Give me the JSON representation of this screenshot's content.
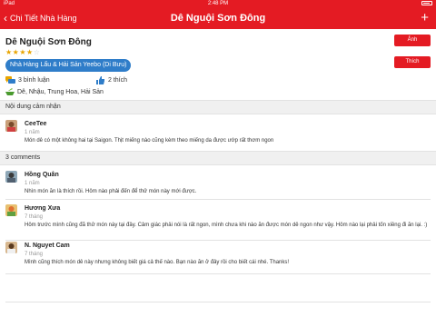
{
  "status_bar": {
    "carrier": "iPad",
    "time": "2:48 PM"
  },
  "nav_bar": {
    "back_label": "Chi Tiết Nhà Hàng",
    "title": "Dê Nguội Sơn Đông",
    "back_icon": "chevron-left-icon",
    "add_icon": "plus-icon"
  },
  "restaurant": {
    "name": "Dê Nguội Sơn Đông",
    "rating": 4,
    "rating_max": 5,
    "category": "Nhà Hàng Lẩu & Hải Sản Yeebo (Di Bưu)",
    "comments_count": "3 bình luận",
    "likes_count": "2 thích",
    "tags": "Dê, Nhậu, Trung Hoa, Hải Sản",
    "photo_button": "Ảnh",
    "like_button": "Thích",
    "colors": {
      "brand_red": "#e41b23",
      "category_blue": "#2f7dc9",
      "star": "#e8a400"
    }
  },
  "impression": {
    "header": "Nội dung cảm nhận",
    "author": "CeeTee",
    "time": "1 năm",
    "text": "Món dê có một không hai tại Saigon. Thịt miếng nào cũng kèm theo miếng da được ướp rất thơm ngon"
  },
  "comments": {
    "header": "3 comments",
    "items": [
      {
        "author": "Hồng Quân",
        "time": "1 năm",
        "text": "Nhìn món ăn là thích rồi. Hôm nào phải đến để thử món này mới được."
      },
      {
        "author": "Hương Xưa",
        "time": "7 tháng",
        "text": "Hôm trước mình cũng đã thử món này tại đây. Cảm giác phải nói là rất ngon, mình chưa khi nào ăn được món dê ngon như vậy. Hôm nào lại phải tốn xiềng đi ăn lại. :)"
      },
      {
        "author": "N. Nguyet Cam",
        "time": "7 tháng",
        "text": "Mình cũng thích món dê này nhưng không biết giá cả thế nào. Bạn nào ăn ở đây rồi cho biết cái nhé. Thanks!"
      }
    ]
  }
}
